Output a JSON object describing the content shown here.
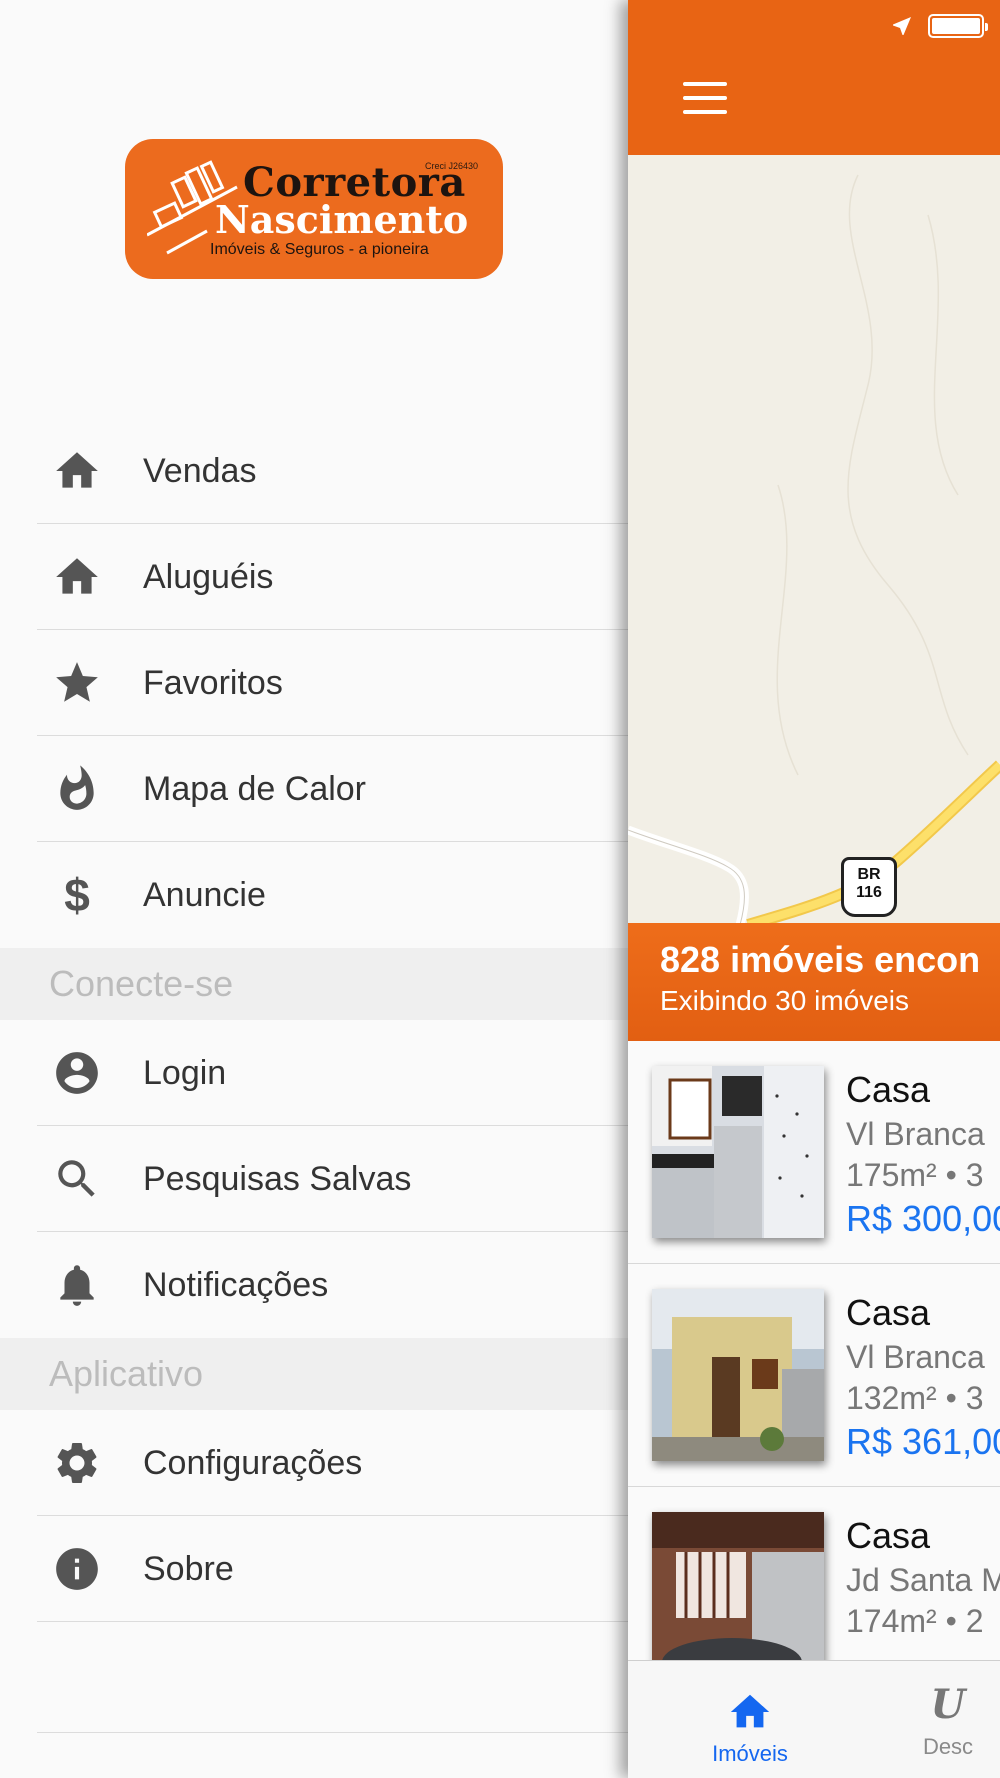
{
  "status_bar": {
    "location_icon": "location-arrow-icon",
    "battery_icon": "battery-icon"
  },
  "logo": {
    "creci": "Creci J26430",
    "line1": "Corretora",
    "line2": "Nascimento",
    "tagline": "Imóveis & Seguros - a pioneira"
  },
  "drawer": {
    "main_items": [
      {
        "label": "Vendas",
        "icon": "home-icon"
      },
      {
        "label": "Aluguéis",
        "icon": "home-icon"
      },
      {
        "label": "Favoritos",
        "icon": "star-icon"
      },
      {
        "label": "Mapa de Calor",
        "icon": "flame-icon"
      },
      {
        "label": "Anuncie",
        "icon": "dollar-icon",
        "glyph": "$"
      }
    ],
    "section_connect": "Conecte-se",
    "connect_items": [
      {
        "label": "Login",
        "icon": "account-icon"
      },
      {
        "label": "Pesquisas Salvas",
        "icon": "search-icon"
      },
      {
        "label": "Notificações",
        "icon": "bell-icon"
      }
    ],
    "section_app": "Aplicativo",
    "app_items": [
      {
        "label": "Configurações",
        "icon": "gear-icon"
      },
      {
        "label": "Sobre",
        "icon": "info-icon"
      }
    ]
  },
  "main": {
    "menu_icon": "hamburger-menu-icon",
    "map": {
      "shield_top": "BR",
      "shield_bottom": "116",
      "ghost_top": "BR",
      "ghost_bottom": "11"
    },
    "results_banner": {
      "title": "828 imóveis encon",
      "subtitle": "Exibindo 30 imóveis"
    },
    "listings": [
      {
        "type": "Casa",
        "address": "Vl Branca",
        "specs": "175m² • 3",
        "price": "R$ 300,00"
      },
      {
        "type": "Casa",
        "address": "Vl Branca",
        "specs": "132m² • 3",
        "price": "R$ 361,00"
      },
      {
        "type": "Casa",
        "address": "Jd Santa M",
        "specs": "174m² • 2",
        "price": ""
      }
    ],
    "tabs": [
      {
        "label": "Imóveis",
        "icon": "home-icon",
        "active": true
      },
      {
        "label": "Desc",
        "icon": "script-icon",
        "glyph": "U",
        "active": false
      }
    ]
  },
  "colors": {
    "brand_orange": "#e86414",
    "price_blue": "#1a74f0",
    "active_tab": "#1467f0"
  }
}
